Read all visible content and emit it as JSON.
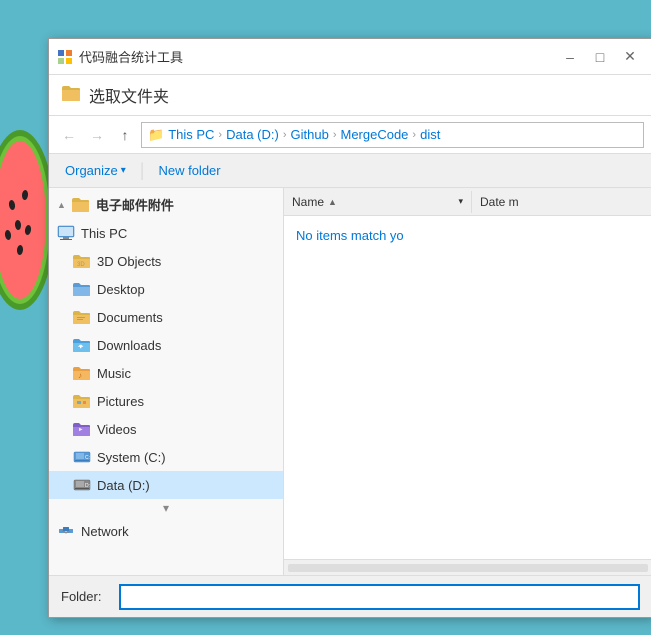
{
  "window": {
    "title": "代码融合统计工具",
    "title_icon": "📊",
    "minimize_label": "–",
    "maximize_label": "□",
    "close_label": "✕"
  },
  "dialog": {
    "header": "选取文件夹"
  },
  "navigation": {
    "back_title": "Back",
    "forward_title": "Forward",
    "up_title": "Up",
    "breadcrumbs": [
      "This PC",
      "Data (D:)",
      "Github",
      "MergeCode",
      "dist"
    ]
  },
  "toolbar": {
    "organize_label": "Organize",
    "new_folder_label": "New folder"
  },
  "sidebar": {
    "items": [
      {
        "id": "email-attachments",
        "label": "电子邮件附件",
        "icon": "folder",
        "level": 0,
        "selected": false,
        "has_expand": true
      },
      {
        "id": "this-pc",
        "label": "This PC",
        "icon": "computer",
        "level": 0,
        "selected": false
      },
      {
        "id": "3d-objects",
        "label": "3D Objects",
        "icon": "folder-3d",
        "level": 1,
        "selected": false
      },
      {
        "id": "desktop",
        "label": "Desktop",
        "icon": "folder-desktop",
        "level": 1,
        "selected": false
      },
      {
        "id": "documents",
        "label": "Documents",
        "icon": "folder-docs",
        "level": 1,
        "selected": false
      },
      {
        "id": "downloads",
        "label": "Downloads",
        "icon": "folder-dl",
        "level": 1,
        "selected": false
      },
      {
        "id": "music",
        "label": "Music",
        "icon": "folder-music",
        "level": 1,
        "selected": false
      },
      {
        "id": "pictures",
        "label": "Pictures",
        "icon": "folder-pics",
        "level": 1,
        "selected": false
      },
      {
        "id": "videos",
        "label": "Videos",
        "icon": "folder-vid",
        "level": 1,
        "selected": false
      },
      {
        "id": "system-c",
        "label": "System (C:)",
        "icon": "drive-c",
        "level": 1,
        "selected": false
      },
      {
        "id": "data-d",
        "label": "Data (D:)",
        "icon": "drive-d",
        "level": 1,
        "selected": true
      },
      {
        "id": "network",
        "label": "Network",
        "icon": "network",
        "level": 0,
        "selected": false
      }
    ]
  },
  "right_pane": {
    "columns": {
      "name": "Name",
      "date": "Date m"
    },
    "no_items_message": "No items match yo"
  },
  "folder_bar": {
    "label": "Folder:",
    "value": "",
    "placeholder": ""
  }
}
